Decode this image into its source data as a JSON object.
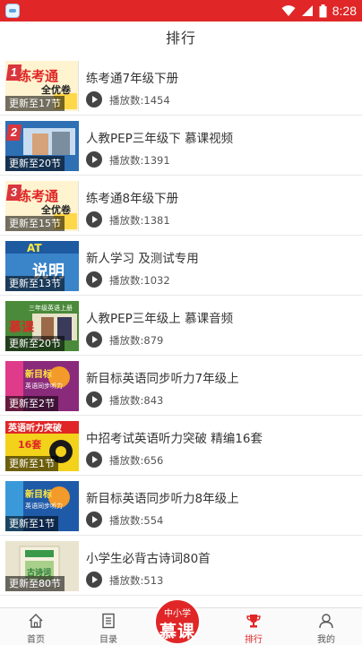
{
  "status_bar": {
    "time": "8:28"
  },
  "header": {
    "title": "排行"
  },
  "items": [
    {
      "rank": "1",
      "cover_text": "练考通",
      "cover_sub": "全优卷",
      "update": "更新至17节",
      "title": "练考通7年级下册",
      "plays": "播放数:1454",
      "cover_bg": "#fff3d0",
      "cover_fg": "#e02626"
    },
    {
      "rank": "2",
      "cover_text": "",
      "cover_sub": "",
      "update": "更新至20节",
      "title": "人教PEP三年级下 慕课视频",
      "plays": "播放数:1391",
      "cover_bg": "#2f6fb4",
      "cover_fg": "#ffffff"
    },
    {
      "rank": "3",
      "cover_text": "练考通",
      "cover_sub": "全优卷",
      "update": "更新至15节",
      "title": "练考通8年级下册",
      "plays": "播放数:1381",
      "cover_bg": "#fff3d0",
      "cover_fg": "#e02626"
    },
    {
      "rank": "",
      "cover_text": "AT",
      "cover_sub": "说明",
      "update": "更新至13节",
      "title": "新人学习 及测试专用",
      "plays": "播放数:1032",
      "cover_bg": "#3a84c9",
      "cover_fg": "#ffe640"
    },
    {
      "rank": "",
      "cover_text": "慕课",
      "cover_sub": "三年级英语上册",
      "update": "更新至20节",
      "title": "人教PEP三年级上 慕课音频",
      "plays": "播放数:879",
      "cover_bg": "#4a8a3a",
      "cover_fg": "#ffffff"
    },
    {
      "rank": "",
      "cover_text": "新目标",
      "cover_sub": "英语同步听力",
      "update": "更新至2节",
      "title": "新目标英语同步听力7年级上",
      "plays": "播放数:843",
      "cover_bg": "#8a2a7a",
      "cover_fg": "#ffe640"
    },
    {
      "rank": "",
      "cover_text": "英语听力突破",
      "cover_sub": "16套",
      "update": "更新至1节",
      "title": "中招考试英语听力突破 精编16套",
      "plays": "播放数:656",
      "cover_bg": "#f2d21a",
      "cover_fg": "#1a3fa6"
    },
    {
      "rank": "",
      "cover_text": "新目标",
      "cover_sub": "英语同步听力",
      "update": "更新至1节",
      "title": "新目标英语同步听力8年级上",
      "plays": "播放数:554",
      "cover_bg": "#1f5aa8",
      "cover_fg": "#ffe640"
    },
    {
      "rank": "",
      "cover_text": "古诗词",
      "cover_sub": "",
      "update": "更新至80节",
      "title": "小学生必背古诗词80首",
      "plays": "播放数:513",
      "cover_bg": "#e9e4cf",
      "cover_fg": "#2a7a3a"
    }
  ],
  "tabs": [
    {
      "label": "首页",
      "icon": "home-icon"
    },
    {
      "label": "目录",
      "icon": "catalog-icon"
    },
    {
      "label": "排行",
      "icon": "trophy-icon"
    },
    {
      "label": "我的",
      "icon": "profile-icon"
    }
  ],
  "center_logo": {
    "line1": "中小学",
    "line2": "慕课"
  },
  "colors": {
    "accent": "#e02626"
  }
}
